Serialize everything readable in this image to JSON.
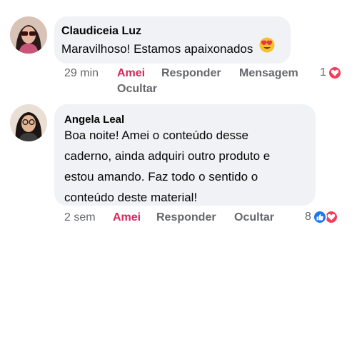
{
  "comments": [
    {
      "author": "Claudiceia Luz",
      "text": "Maravilhoso! Estamos apaixonados",
      "time": "29 min",
      "like_label": "Amei",
      "reply_label": "Responder",
      "message_label": "Mensagem",
      "hide_label": "Ocultar",
      "reaction_count": "1",
      "reactions": [
        "love-icon"
      ]
    },
    {
      "author": "Angela Leal",
      "text_lines": [
        "Boa noite! Amei o conteúdo desse",
        "caderno, ainda adquiri outro produto e",
        "estou amando. Faz todo o sentido o",
        "conteúdo deste material!"
      ],
      "time": "2 sem",
      "like_label": "Amei",
      "reply_label": "Responder",
      "hide_label": "Ocultar",
      "reaction_count": "8",
      "reactions": [
        "like-icon",
        "love-icon"
      ]
    }
  ],
  "colors": {
    "bubble": "#f0f2f5",
    "liked": "#d6275b",
    "secondary_text": "#65676b",
    "love": "#f33e58",
    "like": "#1877f2"
  }
}
